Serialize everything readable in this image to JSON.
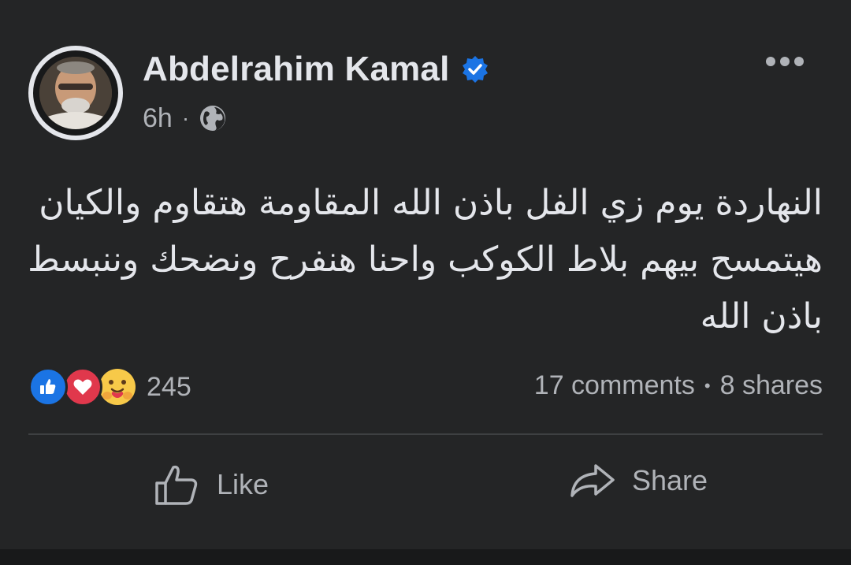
{
  "post": {
    "author": "Abdelrahim Kamal",
    "time": "6h",
    "separator": "·",
    "text_lines": [
      "النهاردة يوم زي الفل باذن الله المقاومة هتقاوم والكيان",
      "هيتمسح بيهم بلاط الكوكب  واحنا هنفرح ونضحك وننبسط",
      "باذن الله"
    ]
  },
  "stats": {
    "reactions_count": "245",
    "comments": "17 comments",
    "bullet": "•",
    "shares": "8 shares"
  },
  "actions": {
    "like_label": "Like",
    "share_label": "Share"
  },
  "icons": {
    "verified": "verified-badge-icon",
    "audience": "globe-icon",
    "more": "more-options-icon",
    "like": "thumbs-up-icon",
    "share": "share-arrow-icon"
  },
  "colors": {
    "background": "#242526",
    "text_primary": "#e4e6eb",
    "text_secondary": "#b0b3b8",
    "verified_blue": "#1b74e4",
    "love_red": "#e0384c"
  }
}
